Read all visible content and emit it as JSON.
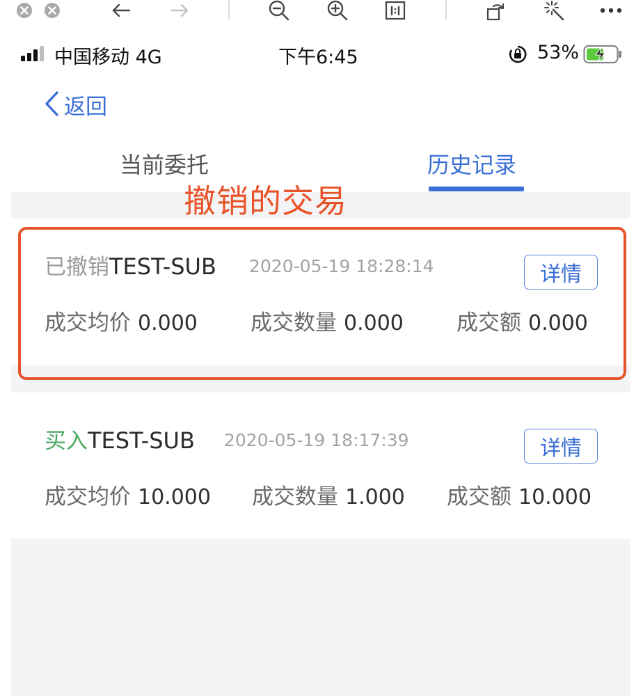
{
  "viewer_toolbar": {
    "icons": [
      "close-circle-icon",
      "stop-circle-icon",
      "arrow-left-icon",
      "arrow-right-icon",
      "zoom-out-icon",
      "zoom-in-icon",
      "actual-size-icon",
      "rotate-icon",
      "magic-wand-icon",
      "more-icon"
    ]
  },
  "statusbar": {
    "carrier": "中国移动 4G",
    "time": "下午6:45",
    "battery": "53%"
  },
  "nav": {
    "back_label": "返回"
  },
  "tabs": {
    "current": "当前委托",
    "history": "历史记录",
    "active": "历史记录"
  },
  "annotation": "撤销的交易",
  "orders": [
    {
      "status": "已撤销",
      "symbol": "TEST-SUB",
      "time": "2020-05-19 18:28:14",
      "detail_label": "详情",
      "avg_price_label": "成交均价",
      "avg_price": "0.000",
      "qty_label": "成交数量",
      "qty": "0.000",
      "amount_label": "成交额",
      "amount": "0.000"
    },
    {
      "status": "买入",
      "symbol": "TEST-SUB",
      "time": "2020-05-19 18:17:39",
      "detail_label": "详情",
      "avg_price_label": "成交均价",
      "avg_price": "10.000",
      "qty_label": "成交数量",
      "qty": "1.000",
      "amount_label": "成交额",
      "amount": "10.000"
    }
  ],
  "colors": {
    "accent": "#3b6fd6",
    "annotation": "#e5552c",
    "buy": "#4aa860",
    "cancelled": "#9a9a9a"
  }
}
